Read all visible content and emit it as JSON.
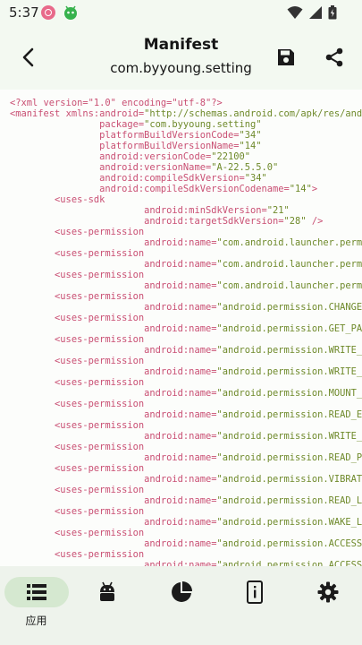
{
  "status": {
    "time": "5:37"
  },
  "header": {
    "title": "Manifest",
    "subtitle": "com.byyoung.setting"
  },
  "code": {
    "lines": [
      [
        {
          "t": "pi",
          "v": "<?xml version=\"1.0\" encoding=\"utf-8\"?>"
        }
      ],
      [
        {
          "t": "tag",
          "v": "<manifest "
        },
        {
          "t": "attr",
          "v": "xmlns:android="
        },
        {
          "t": "val",
          "v": "\"http://schemas.android.com/apk/res/android\""
        }
      ],
      [
        {
          "t": "sp",
          "v": "                "
        },
        {
          "t": "attr",
          "v": "package="
        },
        {
          "t": "val",
          "v": "\"com.byyoung.setting\""
        }
      ],
      [
        {
          "t": "sp",
          "v": "                "
        },
        {
          "t": "attr",
          "v": "platformBuildVersionCode="
        },
        {
          "t": "val",
          "v": "\"34\""
        }
      ],
      [
        {
          "t": "sp",
          "v": "                "
        },
        {
          "t": "attr",
          "v": "platformBuildVersionName="
        },
        {
          "t": "val",
          "v": "\"14\""
        }
      ],
      [
        {
          "t": "sp",
          "v": "                "
        },
        {
          "t": "attr",
          "v": "android:versionCode="
        },
        {
          "t": "val",
          "v": "\"22100\""
        }
      ],
      [
        {
          "t": "sp",
          "v": "                "
        },
        {
          "t": "attr",
          "v": "android:versionName="
        },
        {
          "t": "val",
          "v": "\"A-22.5.5.0\""
        }
      ],
      [
        {
          "t": "sp",
          "v": "                "
        },
        {
          "t": "attr",
          "v": "android:compileSdkVersion="
        },
        {
          "t": "val",
          "v": "\"34\""
        }
      ],
      [
        {
          "t": "sp",
          "v": "                "
        },
        {
          "t": "attr",
          "v": "android:compileSdkVersionCodename="
        },
        {
          "t": "val",
          "v": "\"14\""
        },
        {
          "t": "tag",
          "v": ">"
        }
      ],
      [
        {
          "t": "sp",
          "v": "        "
        },
        {
          "t": "tag",
          "v": "<uses-sdk"
        }
      ],
      [
        {
          "t": "sp",
          "v": "                        "
        },
        {
          "t": "attr",
          "v": "android:minSdkVersion="
        },
        {
          "t": "val",
          "v": "\"21\""
        }
      ],
      [
        {
          "t": "sp",
          "v": "                        "
        },
        {
          "t": "attr",
          "v": "android:targetSdkVersion="
        },
        {
          "t": "val",
          "v": "\"28\""
        },
        {
          "t": "tag",
          "v": " />"
        }
      ],
      [
        {
          "t": "sp",
          "v": "        "
        },
        {
          "t": "tag",
          "v": "<uses-permission"
        }
      ],
      [
        {
          "t": "sp",
          "v": "                        "
        },
        {
          "t": "attr",
          "v": "android:name="
        },
        {
          "t": "val",
          "v": "\"com.android.launcher.permission.READ_SETTINGS\""
        }
      ],
      [
        {
          "t": "sp",
          "v": "        "
        },
        {
          "t": "tag",
          "v": "<uses-permission"
        }
      ],
      [
        {
          "t": "sp",
          "v": "                        "
        },
        {
          "t": "attr",
          "v": "android:name="
        },
        {
          "t": "val",
          "v": "\"com.android.launcher.permission.WRITE_SETTINGS\""
        }
      ],
      [
        {
          "t": "sp",
          "v": "        "
        },
        {
          "t": "tag",
          "v": "<uses-permission"
        }
      ],
      [
        {
          "t": "sp",
          "v": "                        "
        },
        {
          "t": "attr",
          "v": "android:name="
        },
        {
          "t": "val",
          "v": "\"com.android.launcher.permission.INSTALL_SHORTCUT\""
        }
      ],
      [
        {
          "t": "sp",
          "v": "        "
        },
        {
          "t": "tag",
          "v": "<uses-permission"
        }
      ],
      [
        {
          "t": "sp",
          "v": "                        "
        },
        {
          "t": "attr",
          "v": "android:name="
        },
        {
          "t": "val",
          "v": "\"android.permission.CHANGE_NETWORK_STATE\""
        }
      ],
      [
        {
          "t": "sp",
          "v": "        "
        },
        {
          "t": "tag",
          "v": "<uses-permission"
        }
      ],
      [
        {
          "t": "sp",
          "v": "                        "
        },
        {
          "t": "attr",
          "v": "android:name="
        },
        {
          "t": "val",
          "v": "\"android.permission.GET_PACKAGE_SIZE\""
        }
      ],
      [
        {
          "t": "sp",
          "v": "        "
        },
        {
          "t": "tag",
          "v": "<uses-permission"
        }
      ],
      [
        {
          "t": "sp",
          "v": "                        "
        },
        {
          "t": "attr",
          "v": "android:name="
        },
        {
          "t": "val",
          "v": "\"android.permission.WRITE_SETTINGS\""
        }
      ],
      [
        {
          "t": "sp",
          "v": "        "
        },
        {
          "t": "tag",
          "v": "<uses-permission"
        }
      ],
      [
        {
          "t": "sp",
          "v": "                        "
        },
        {
          "t": "attr",
          "v": "android:name="
        },
        {
          "t": "val",
          "v": "\"android.permission.WRITE_SECURE_SETTINGS\""
        }
      ],
      [
        {
          "t": "sp",
          "v": "        "
        },
        {
          "t": "tag",
          "v": "<uses-permission"
        }
      ],
      [
        {
          "t": "sp",
          "v": "                        "
        },
        {
          "t": "attr",
          "v": "android:name="
        },
        {
          "t": "val",
          "v": "\"android.permission.MOUNT_UNMOUNT_FILESYSTEMS\""
        }
      ],
      [
        {
          "t": "sp",
          "v": "        "
        },
        {
          "t": "tag",
          "v": "<uses-permission"
        }
      ],
      [
        {
          "t": "sp",
          "v": "                        "
        },
        {
          "t": "attr",
          "v": "android:name="
        },
        {
          "t": "val",
          "v": "\"android.permission.READ_EXTERNAL_STORAGE\""
        }
      ],
      [
        {
          "t": "sp",
          "v": "        "
        },
        {
          "t": "tag",
          "v": "<uses-permission"
        }
      ],
      [
        {
          "t": "sp",
          "v": "                        "
        },
        {
          "t": "attr",
          "v": "android:name="
        },
        {
          "t": "val",
          "v": "\"android.permission.WRITE_EXTERNAL_STORAGE\""
        }
      ],
      [
        {
          "t": "sp",
          "v": "        "
        },
        {
          "t": "tag",
          "v": "<uses-permission"
        }
      ],
      [
        {
          "t": "sp",
          "v": "                        "
        },
        {
          "t": "attr",
          "v": "android:name="
        },
        {
          "t": "val",
          "v": "\"android.permission.READ_PHONE_STATE\""
        }
      ],
      [
        {
          "t": "sp",
          "v": "        "
        },
        {
          "t": "tag",
          "v": "<uses-permission"
        }
      ],
      [
        {
          "t": "sp",
          "v": "                        "
        },
        {
          "t": "attr",
          "v": "android:name="
        },
        {
          "t": "val",
          "v": "\"android.permission.VIBRATE\""
        }
      ],
      [
        {
          "t": "sp",
          "v": "        "
        },
        {
          "t": "tag",
          "v": "<uses-permission"
        }
      ],
      [
        {
          "t": "sp",
          "v": "                        "
        },
        {
          "t": "attr",
          "v": "android:name="
        },
        {
          "t": "val",
          "v": "\"android.permission.READ_LOGS\""
        }
      ],
      [
        {
          "t": "sp",
          "v": "        "
        },
        {
          "t": "tag",
          "v": "<uses-permission"
        }
      ],
      [
        {
          "t": "sp",
          "v": "                        "
        },
        {
          "t": "attr",
          "v": "android:name="
        },
        {
          "t": "val",
          "v": "\"android.permission.WAKE_LOCK\""
        }
      ],
      [
        {
          "t": "sp",
          "v": "        "
        },
        {
          "t": "tag",
          "v": "<uses-permission"
        }
      ],
      [
        {
          "t": "sp",
          "v": "                        "
        },
        {
          "t": "attr",
          "v": "android:name="
        },
        {
          "t": "val",
          "v": "\"android.permission.ACCESS_WIFI_STATE\""
        }
      ],
      [
        {
          "t": "sp",
          "v": "        "
        },
        {
          "t": "tag",
          "v": "<uses-permission"
        }
      ],
      [
        {
          "t": "sp",
          "v": "                        "
        },
        {
          "t": "attr",
          "v": "android:name="
        },
        {
          "t": "val",
          "v": "\"android.permission.ACCESS_NETWORK_STATE\""
        }
      ]
    ]
  },
  "nav": {
    "items": [
      {
        "label": "应用",
        "icon": "list-icon",
        "active": true
      },
      {
        "label": "",
        "icon": "android-icon",
        "active": false
      },
      {
        "label": "",
        "icon": "pie-chart-icon",
        "active": false
      },
      {
        "label": "",
        "icon": "device-info-icon",
        "active": false
      },
      {
        "label": "",
        "icon": "gear-icon",
        "active": false
      }
    ]
  },
  "colors": {
    "tag": "#c94f73",
    "value": "#6f8a2b",
    "background": "#f3f9f1",
    "nav_active": "#d5e8d0"
  }
}
